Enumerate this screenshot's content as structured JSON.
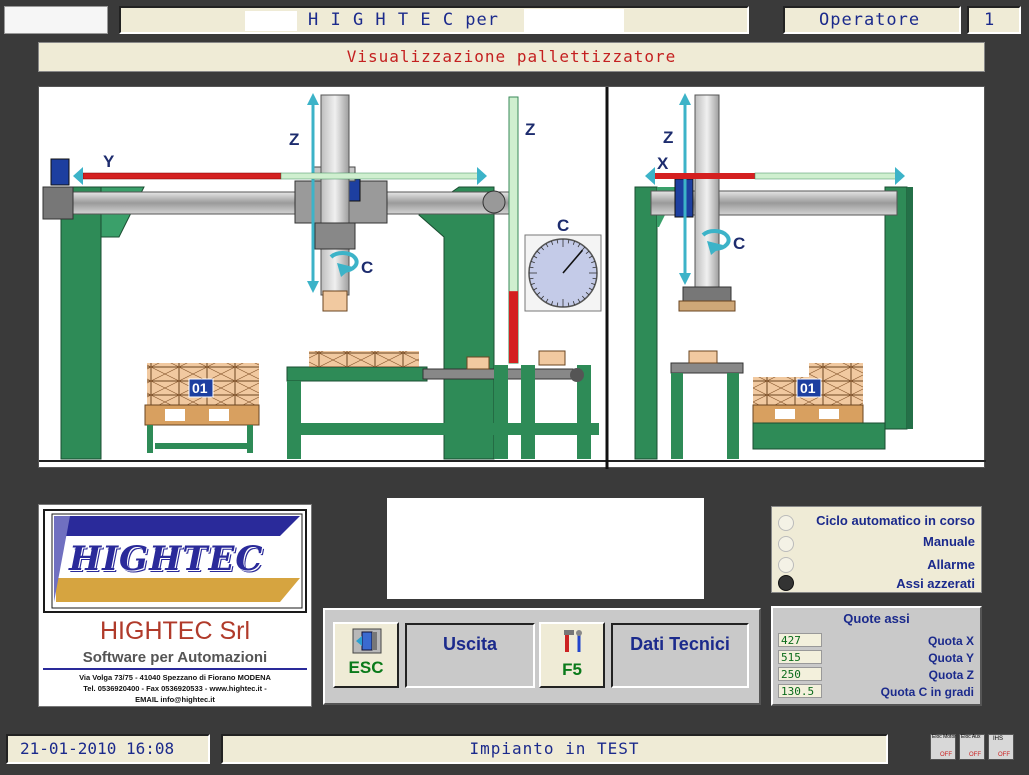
{
  "header": {
    "title": "H I G H T E C per",
    "operator_label": "Operatore",
    "operator_number": "1"
  },
  "section_title": "Visualizzazione pallettizzatore",
  "scene": {
    "axis_y": "Y",
    "axis_z_left": "Z",
    "axis_c_left": "C",
    "axis_z_mid": "Z",
    "axis_c_gauge": "C",
    "axis_z_right": "Z",
    "axis_x_right": "X",
    "axis_c_right": "C",
    "pallet_left": "01",
    "pallet_right": "01",
    "z_level": 0.27,
    "c_angle_deg": 130.5
  },
  "logo": {
    "brand": "HIGHTEC",
    "company": "HIGHTEC Srl",
    "tagline": "Software per Automazioni",
    "address": "Via Volga 73/75 - 41040 Spezzano di Fiorano MODENA",
    "contacts": "Tel. 0536920400 - Fax 0536920533 - www.hightec.it -",
    "email": "EMAIL info@hightec.it"
  },
  "status": {
    "items": [
      {
        "label": "Ciclo automatico in corso",
        "active": false
      },
      {
        "label": "Manuale",
        "active": false
      },
      {
        "label": "Allarme",
        "active": false
      },
      {
        "label": "Assi azzerati",
        "active": true
      }
    ]
  },
  "buttons": {
    "esc_key": "ESC",
    "esc_label": "Uscita",
    "f5_key": "F5",
    "f5_label": "Dati Tecnici"
  },
  "quotes": {
    "title": "Quote assi",
    "rows": [
      {
        "value": "427",
        "label": "Quota X"
      },
      {
        "value": "515",
        "label": "Quota Y"
      },
      {
        "value": "250",
        "label": "Quota Z"
      },
      {
        "value": "130.5",
        "label": "Quota C in gradi"
      }
    ]
  },
  "footer": {
    "datetime": "21-01-2010 16:08",
    "status": "Impianto in TEST",
    "mini_icons": [
      {
        "top": "Eloc Motor",
        "bottom": "OFF"
      },
      {
        "top": "Eloc Aux",
        "bottom": "OFF"
      },
      {
        "top": "IHS",
        "bottom": "OFF"
      }
    ]
  },
  "colors": {
    "machine_green": "#2e8b57",
    "axis_red": "#d42020",
    "axis_light": "#cfefcf",
    "accent_navy": "#1b2a8c",
    "panel_cream": "#efebd6"
  }
}
